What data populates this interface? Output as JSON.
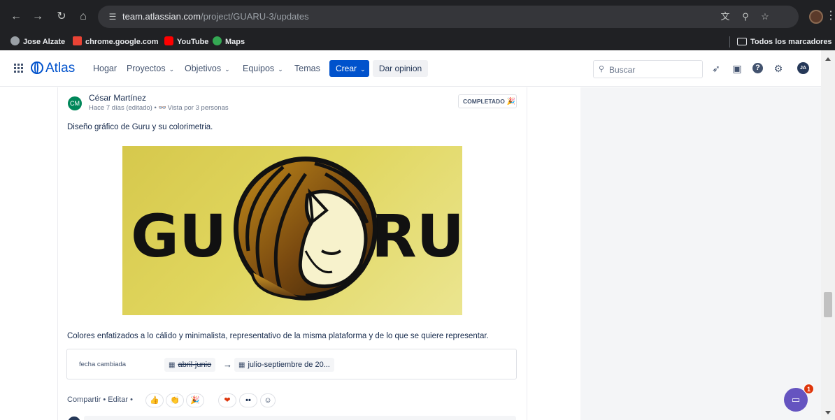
{
  "browser": {
    "url_host": "team.atlassian.com",
    "url_path": "/project/GUARU-3/updates",
    "bookmarks": [
      {
        "label": "Jose Alzate",
        "color": "#9aa0a6"
      },
      {
        "label": "chrome.google.com",
        "color": "#ea4335"
      },
      {
        "label": "YouTube",
        "color": "#ff0000"
      },
      {
        "label": "Maps",
        "color": "#34a853"
      }
    ],
    "all_bookmarks_label": "Todos los marcadores"
  },
  "header": {
    "logo": "Atlas",
    "nav": [
      {
        "label": "Hogar",
        "has_menu": false
      },
      {
        "label": "Proyectos",
        "has_menu": true
      },
      {
        "label": "Objetivos",
        "has_menu": true
      },
      {
        "label": "Equipos",
        "has_menu": true
      },
      {
        "label": "Temas",
        "has_menu": false
      }
    ],
    "create_label": "Crear",
    "feedback_label": "Dar opinion",
    "search_placeholder": "Buscar",
    "user_initials": "JA"
  },
  "post": {
    "author_initials": "CM",
    "author": "César Martínez",
    "meta_time": "Hace 7 días (editado) •",
    "meta_views": "Vista por 3 personas",
    "status": "COMPLETADO",
    "intro": "Diseño gráfico de Guru y su colorimetria.",
    "image_text_left": "GU",
    "image_text_right": "RU",
    "description": "Colores enfatizados a lo cálido y minimalista, representativo de la misma plataforma y de lo que se quiere representar.",
    "change": {
      "label": "fecha cambiada",
      "old_value": "abril-junio",
      "new_value": "julio-septiembre de 20..."
    },
    "share_label": "Compartir",
    "edit_label": "Editar",
    "separator": "•",
    "reactions": [
      {
        "name": "thumbs-up",
        "glyph": "👍"
      },
      {
        "name": "clap",
        "glyph": "👏"
      },
      {
        "name": "party",
        "glyph": "🎉"
      },
      {
        "name": "heart",
        "glyph": "❤"
      },
      {
        "name": "eyes",
        "glyph": "••"
      },
      {
        "name": "add-reaction",
        "glyph": "☺"
      }
    ]
  },
  "chat": {
    "badge_count": "1"
  },
  "colors": {
    "brand": "#0052cc",
    "author_avatar": "#00875a",
    "chat_button": "#6554c0",
    "image_bg": "#ddd35a"
  }
}
